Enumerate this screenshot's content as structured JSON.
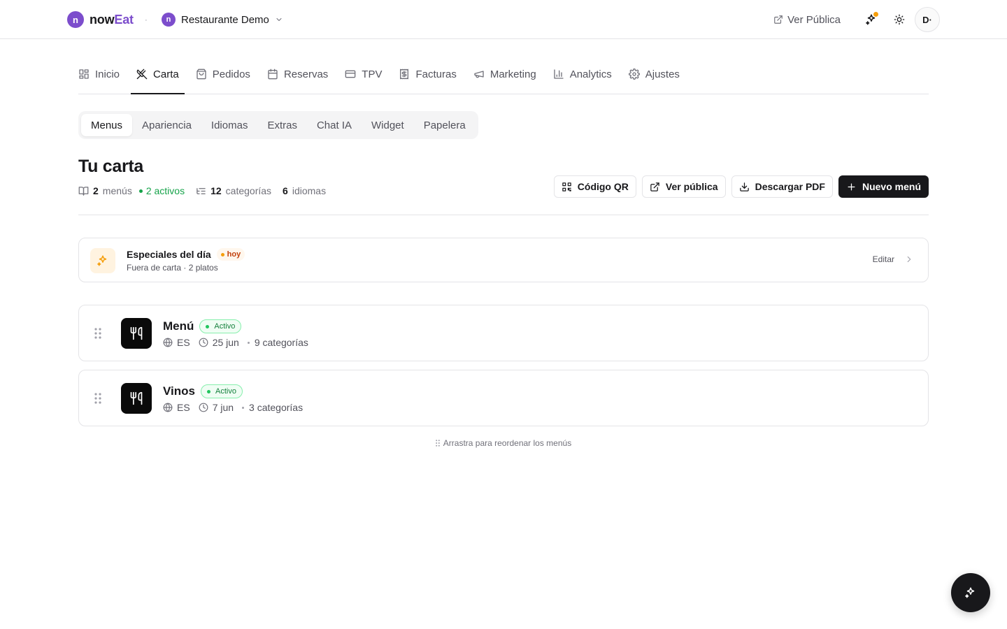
{
  "brand": {
    "logo_letter": "n",
    "name_part1": "now",
    "name_part2": "Eat",
    "separator": "·"
  },
  "restaurant": {
    "logo_letter": "n",
    "name": "Restaurante Demo"
  },
  "header": {
    "ver_publica": "Ver Pública",
    "avatar": "D·"
  },
  "nav": {
    "items": [
      {
        "label": "Inicio",
        "icon": "grid-icon"
      },
      {
        "label": "Carta",
        "icon": "utensils-crossed-icon",
        "active": true
      },
      {
        "label": "Pedidos",
        "icon": "shopping-bag-icon"
      },
      {
        "label": "Reservas",
        "icon": "calendar-icon"
      },
      {
        "label": "TPV",
        "icon": "credit-card-icon"
      },
      {
        "label": "Facturas",
        "icon": "receipt-icon"
      },
      {
        "label": "Marketing",
        "icon": "megaphone-icon"
      },
      {
        "label": "Analytics",
        "icon": "bar-chart-icon"
      },
      {
        "label": "Ajustes",
        "icon": "gear-icon"
      }
    ]
  },
  "subtabs": [
    "Menus",
    "Apariencia",
    "Idiomas",
    "Extras",
    "Chat IA",
    "Widget",
    "Papelera"
  ],
  "page": {
    "title": "Tu carta",
    "stats": {
      "menus_count": "2",
      "menus_label": "menús",
      "active_label": "2 activos",
      "categories_count": "12",
      "categories_label": "categorías",
      "languages_count": "6",
      "languages_label": "idiomas"
    }
  },
  "actions": {
    "qr": "Código QR",
    "public": "Ver pública",
    "pdf": "Descargar PDF",
    "new_menu": "Nuevo menú"
  },
  "specials": {
    "title": "Especiales del día",
    "badge": "hoy",
    "subtitle": "Fuera de carta · 2 platos",
    "edit": "Editar"
  },
  "menus": [
    {
      "name": "Menú",
      "status": "Activo",
      "lang": "ES",
      "date": "25 jun",
      "categories": "9 categorías"
    },
    {
      "name": "Vinos",
      "status": "Activo",
      "lang": "ES",
      "date": "7 jun",
      "categories": "3 categorías"
    }
  ],
  "reorder_hint": "Arrastra para reordenar los menús",
  "colors": {
    "accent": "#7c4dcc",
    "active_green": "#16a34a",
    "notification": "#f59e0b",
    "dark": "#18181b"
  }
}
